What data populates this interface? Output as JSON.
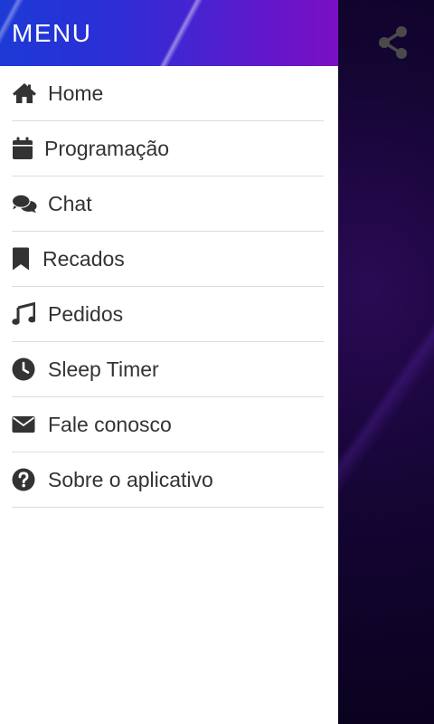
{
  "colors": {
    "header_start": "#1d3ad6",
    "header_end": "#7a10c4",
    "drawer_bg": "#ffffff",
    "text": "#333333",
    "divider": "#dddddd",
    "app_bg": "#0f0320"
  },
  "drawer": {
    "title": "MENU",
    "items": [
      {
        "label": "Home",
        "icon": "home-icon"
      },
      {
        "label": "Programação",
        "icon": "calendar-icon"
      },
      {
        "label": "Chat",
        "icon": "chat-icon"
      },
      {
        "label": "Recados",
        "icon": "bookmark-icon"
      },
      {
        "label": "Pedidos",
        "icon": "music-note-icon"
      },
      {
        "label": "Sleep Timer",
        "icon": "clock-icon"
      },
      {
        "label": "Fale conosco",
        "icon": "envelope-icon"
      },
      {
        "label": "Sobre o aplicativo",
        "icon": "question-circle-icon"
      }
    ]
  },
  "app": {
    "share_icon": "share-icon"
  }
}
